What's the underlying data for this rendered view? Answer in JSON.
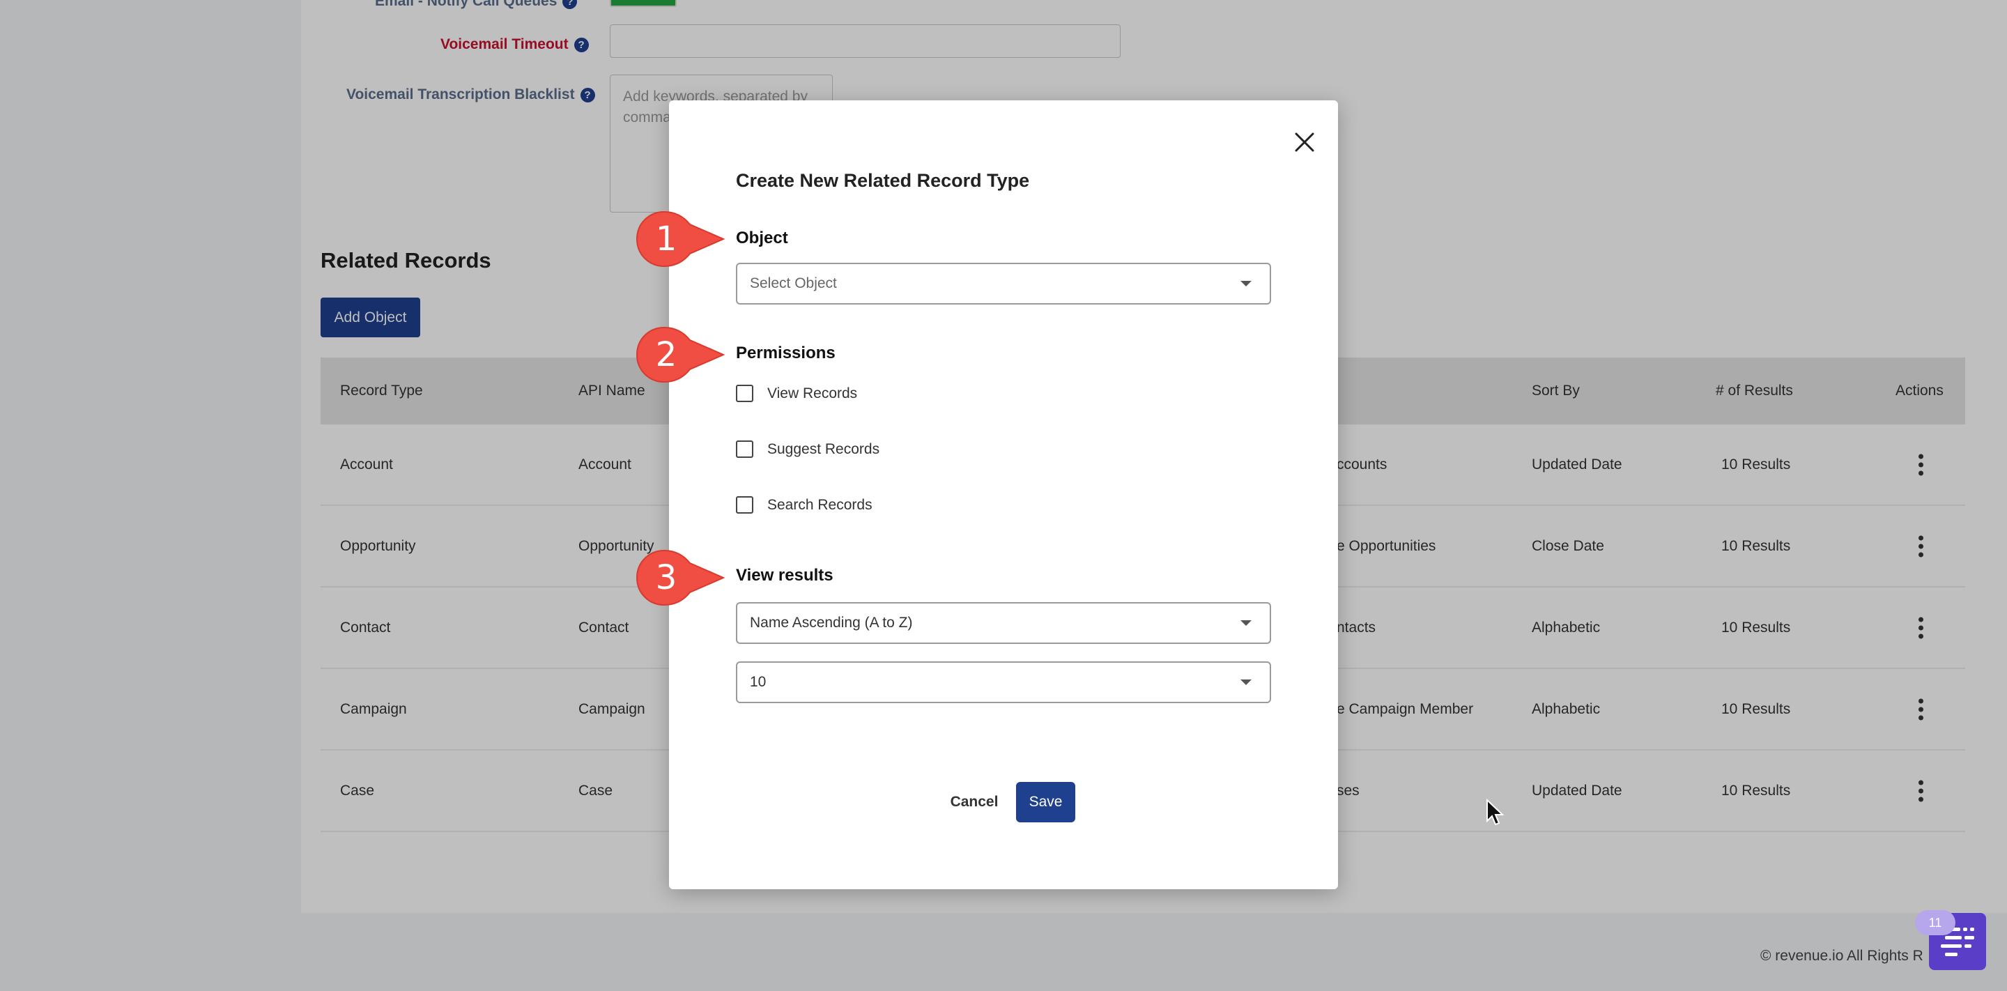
{
  "settings_form": {
    "email_label": "Email - Notify Call Queues",
    "voicemail_timeout_label": "Voicemail Timeout",
    "voicemail_timeout_value": "",
    "blacklist_label": "Voicemail Transcription Blacklist",
    "blacklist_placeholder": "Add keywords, separated by comma"
  },
  "related_records": {
    "title": "Related Records",
    "add_button": "Add Object",
    "columns": [
      "Record Type",
      "API Name",
      "",
      "Sort By",
      "# of Results",
      "Actions"
    ],
    "rows": [
      {
        "record_type": "Account",
        "api_name": "Account",
        "view": "ccounts",
        "sort_by": "Updated Date",
        "results": "10 Results"
      },
      {
        "record_type": "Opportunity",
        "api_name": "Opportunity",
        "view": "e Opportunities",
        "sort_by": "Close Date",
        "results": "10 Results"
      },
      {
        "record_type": "Contact",
        "api_name": "Contact",
        "view": "ntacts",
        "sort_by": "Alphabetic",
        "results": "10 Results"
      },
      {
        "record_type": "Campaign",
        "api_name": "Campaign",
        "view": "e Campaign Member",
        "sort_by": "Alphabetic",
        "results": "10 Results"
      },
      {
        "record_type": "Case",
        "api_name": "Case",
        "view": "ses",
        "sort_by": "Updated Date",
        "results": "10 Results"
      }
    ]
  },
  "footer": {
    "copyright": "© revenue.io All Rights R"
  },
  "chat_widget": {
    "badge": "11"
  },
  "modal": {
    "title": "Create New Related Record Type",
    "object_label": "Object",
    "object_placeholder": "Select Object",
    "permissions_label": "Permissions",
    "permissions": [
      "View Records",
      "Suggest Records",
      "Search Records"
    ],
    "view_results_label": "View results",
    "sort_value": "Name Ascending (A to Z)",
    "count_value": "10",
    "cancel": "Cancel",
    "save": "Save"
  },
  "callouts": [
    "1",
    "2",
    "3"
  ],
  "colors": {
    "primary": "#1f3f8f",
    "callout": "#f04e42",
    "required": "#c8102e",
    "toggle_on": "#22a642"
  }
}
